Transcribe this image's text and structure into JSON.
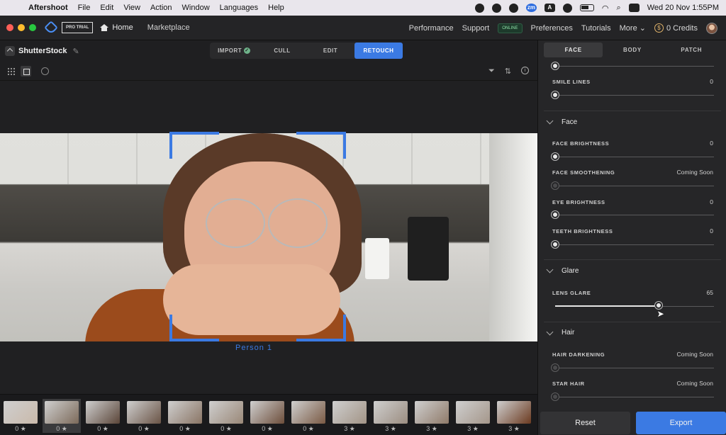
{
  "menubar": {
    "app_name": "Aftershoot",
    "items": [
      "File",
      "Edit",
      "View",
      "Action",
      "Window",
      "Languages",
      "Help"
    ],
    "datetime": "Wed 20 Nov  1:55PM",
    "zm_label": "zm",
    "a_label": "A"
  },
  "titlebar": {
    "pro_trial": "PRO TRIAL",
    "home": "Home",
    "marketplace": "Marketplace",
    "performance": "Performance",
    "support": "Support",
    "online": "ONLINE",
    "preferences": "Preferences",
    "tutorials": "Tutorials",
    "more": "More",
    "coin_symbol": "$",
    "credits": "0 Credits"
  },
  "project": {
    "name": "ShutterStock"
  },
  "modes": [
    "IMPORT",
    "CULL",
    "EDIT",
    "RETOUCH"
  ],
  "active_mode": "RETOUCH",
  "viewer": {
    "person_label": "Person 1"
  },
  "filmstrip": [
    {
      "rating": "0",
      "selected": false,
      "color": "#c9b9aa"
    },
    {
      "rating": "0",
      "selected": true,
      "color": "#7c6a5a"
    },
    {
      "rating": "0",
      "selected": false,
      "color": "#5a4538"
    },
    {
      "rating": "0",
      "selected": false,
      "color": "#6a5446"
    },
    {
      "rating": "0",
      "selected": false,
      "color": "#8a7565"
    },
    {
      "rating": "0",
      "selected": false,
      "color": "#9a8878"
    },
    {
      "rating": "0",
      "selected": false,
      "color": "#6d4e3b"
    },
    {
      "rating": "0",
      "selected": false,
      "color": "#7a5a44"
    },
    {
      "rating": "3",
      "selected": false,
      "color": "#a29486"
    },
    {
      "rating": "3",
      "selected": false,
      "color": "#9b8d80"
    },
    {
      "rating": "3",
      "selected": false,
      "color": "#8f7a69"
    },
    {
      "rating": "3",
      "selected": false,
      "color": "#a4968a"
    },
    {
      "rating": "3",
      "selected": false,
      "color": "#6b3a20"
    }
  ],
  "retouch_tabs": [
    "FACE",
    "BODY",
    "PATCH"
  ],
  "active_retouch_tab": "FACE",
  "controls": {
    "smile_lines": {
      "label": "SMILE LINES",
      "value": "0"
    },
    "face_section": "Face",
    "face_brightness": {
      "label": "FACE BRIGHTNESS",
      "value": "0"
    },
    "face_smoothening": {
      "label": "FACE SMOOTHENING",
      "value": "Coming Soon"
    },
    "eye_brightness": {
      "label": "EYE BRIGHTNESS",
      "value": "0"
    },
    "teeth_brightness": {
      "label": "TEETH BRIGHTNESS",
      "value": "0"
    },
    "glare_section": "Glare",
    "lens_glare": {
      "label": "LENS GLARE",
      "value": "65",
      "level": 0.65
    },
    "hair_section": "Hair",
    "hair_darkening": {
      "label": "HAIR DARKENING",
      "value": "Coming Soon"
    },
    "star_hair": {
      "label": "STAR HAIR",
      "value": "Coming Soon"
    }
  },
  "buttons": {
    "reset": "Reset",
    "export": "Export"
  },
  "colors": {
    "accent": "#3b7ae3",
    "panel": "#262628"
  }
}
